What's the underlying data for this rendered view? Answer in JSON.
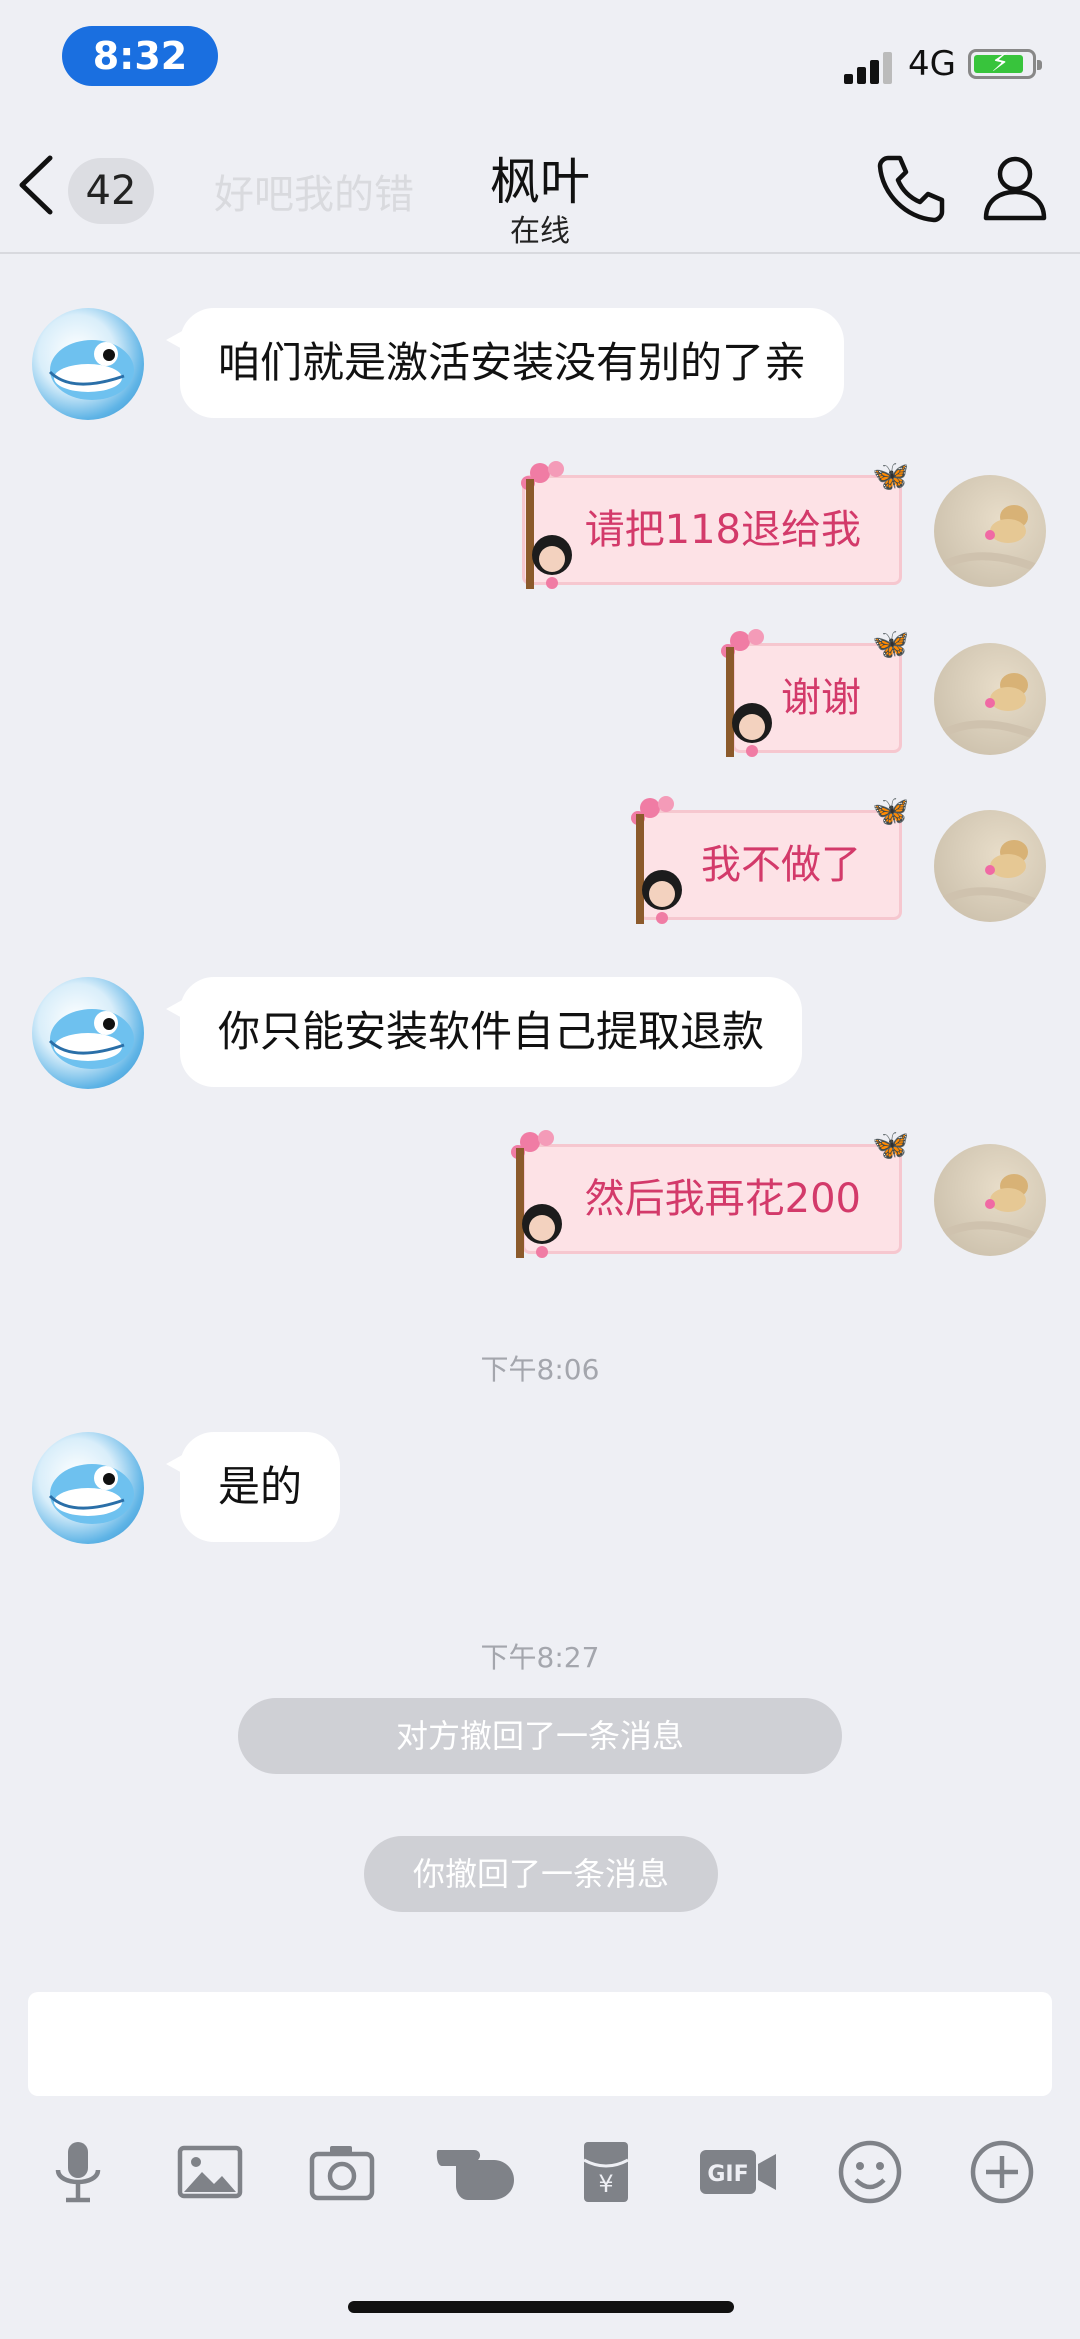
{
  "status_bar": {
    "time": "8:32",
    "network": "4G",
    "icons": [
      "signal-icon",
      "battery-charging-icon"
    ]
  },
  "nav": {
    "unread_badge": "42",
    "ghost_text": "好吧我的错",
    "contact_name": "枫叶",
    "presence": "在线",
    "icons": [
      "back-icon",
      "phone-icon",
      "profile-icon"
    ]
  },
  "messages": [
    {
      "side": "left",
      "text": "咱们就是激活安装没有别的了亲"
    },
    {
      "side": "right",
      "text": "请把118退给我"
    },
    {
      "side": "right",
      "text": "谢谢"
    },
    {
      "side": "right",
      "text": "我不做了"
    },
    {
      "side": "left",
      "text": "你只能安装软件自己提取退款"
    },
    {
      "side": "right",
      "text": "然后我再花200"
    },
    {
      "type": "timestamp",
      "text": "下午8:06"
    },
    {
      "side": "left",
      "text": "是的"
    },
    {
      "type": "timestamp",
      "text": "下午8:27"
    },
    {
      "type": "system",
      "text": "对方撤回了一条消息"
    },
    {
      "type": "system",
      "text": "你撤回了一条消息"
    }
  ],
  "input": {
    "placeholder": ""
  },
  "toolbar": {
    "items": [
      "microphone-icon",
      "image-icon",
      "camera-icon",
      "poke-hand-icon",
      "red-packet-icon",
      "gif-icon",
      "emoji-icon",
      "plus-icon"
    ]
  },
  "colors": {
    "time_pill": "#1a6fe0",
    "bubble_right_bg": "#fde2e6",
    "bubble_right_text": "#d33a6a",
    "bubble_left_bg": "#ffffff",
    "background": "#eeeff4"
  }
}
